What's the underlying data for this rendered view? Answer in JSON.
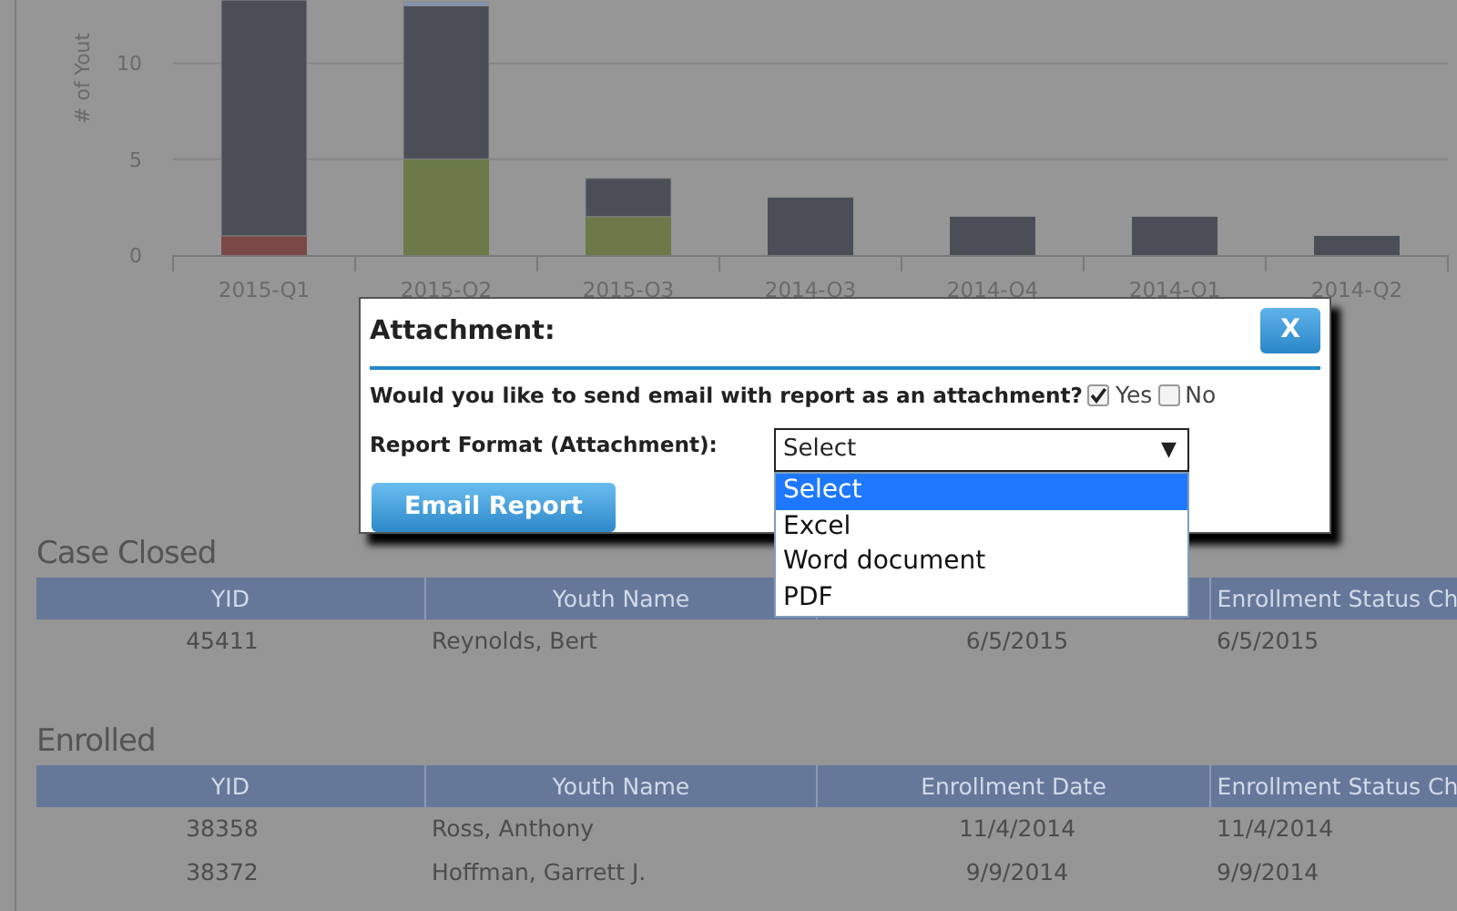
{
  "chart": {
    "chart_data": {
      "type": "bar",
      "stacked": true,
      "ylabel": "# of Yout",
      "categories": [
        "2015-Q1",
        "2015-Q2",
        "2015-Q3",
        "2014-Q3",
        "2014-Q4",
        "2014-Q1",
        "2014-Q2"
      ],
      "ylim": [
        0,
        13.3
      ],
      "yticks": [
        0,
        5,
        10
      ],
      "series": [
        {
          "color": "#7b4848",
          "values": [
            1,
            0,
            0,
            0,
            0,
            0,
            0
          ]
        },
        {
          "color": "#6b7a48",
          "values": [
            0,
            5,
            2,
            0,
            0,
            0,
            0
          ]
        },
        {
          "color": "#4a4f57",
          "values": [
            12.3,
            8,
            2,
            3,
            2,
            2,
            1
          ]
        },
        {
          "color": "#8294b4",
          "values": [
            0,
            0.2,
            0,
            0,
            0,
            0,
            0
          ]
        }
      ]
    }
  },
  "modal": {
    "title": "Attachment:",
    "close_label": "X",
    "question": "Would you like to send email with report as an attachment?",
    "options": [
      {
        "label": "Yes",
        "checked": true
      },
      {
        "label": "No",
        "checked": false
      }
    ],
    "format_label": "Report Format (Attachment):",
    "format_select": {
      "value": "Select",
      "arrow": "▼",
      "expanded": true,
      "options": [
        {
          "label": "Select",
          "selected": true
        },
        {
          "label": "Excel",
          "selected": false
        },
        {
          "label": "Word document",
          "selected": false
        },
        {
          "label": "PDF",
          "selected": false
        }
      ]
    },
    "submit": "Email Report"
  },
  "sections": [
    {
      "title": "Case Closed",
      "columns": [
        {
          "label": "YID"
        },
        {
          "label": "Youth Name"
        },
        {},
        {
          "label": "Enrollment Status Ch"
        }
      ],
      "rows": [
        [
          "45411",
          "Reynolds, Bert",
          "6/5/2015",
          "6/5/2015"
        ]
      ]
    },
    {
      "title": "Enrolled",
      "columns": [
        {
          "label": "YID"
        },
        {
          "label": "Youth Name"
        },
        {
          "label": "Enrollment Date"
        },
        {
          "label": "Enrollment Status Ch"
        }
      ],
      "rows": [
        [
          "38358",
          "Ross, Anthony",
          "11/4/2014",
          "11/4/2014"
        ],
        [
          "38372",
          "Hoffman, Garrett J.",
          "9/9/2014",
          "9/9/2014"
        ]
      ]
    }
  ]
}
